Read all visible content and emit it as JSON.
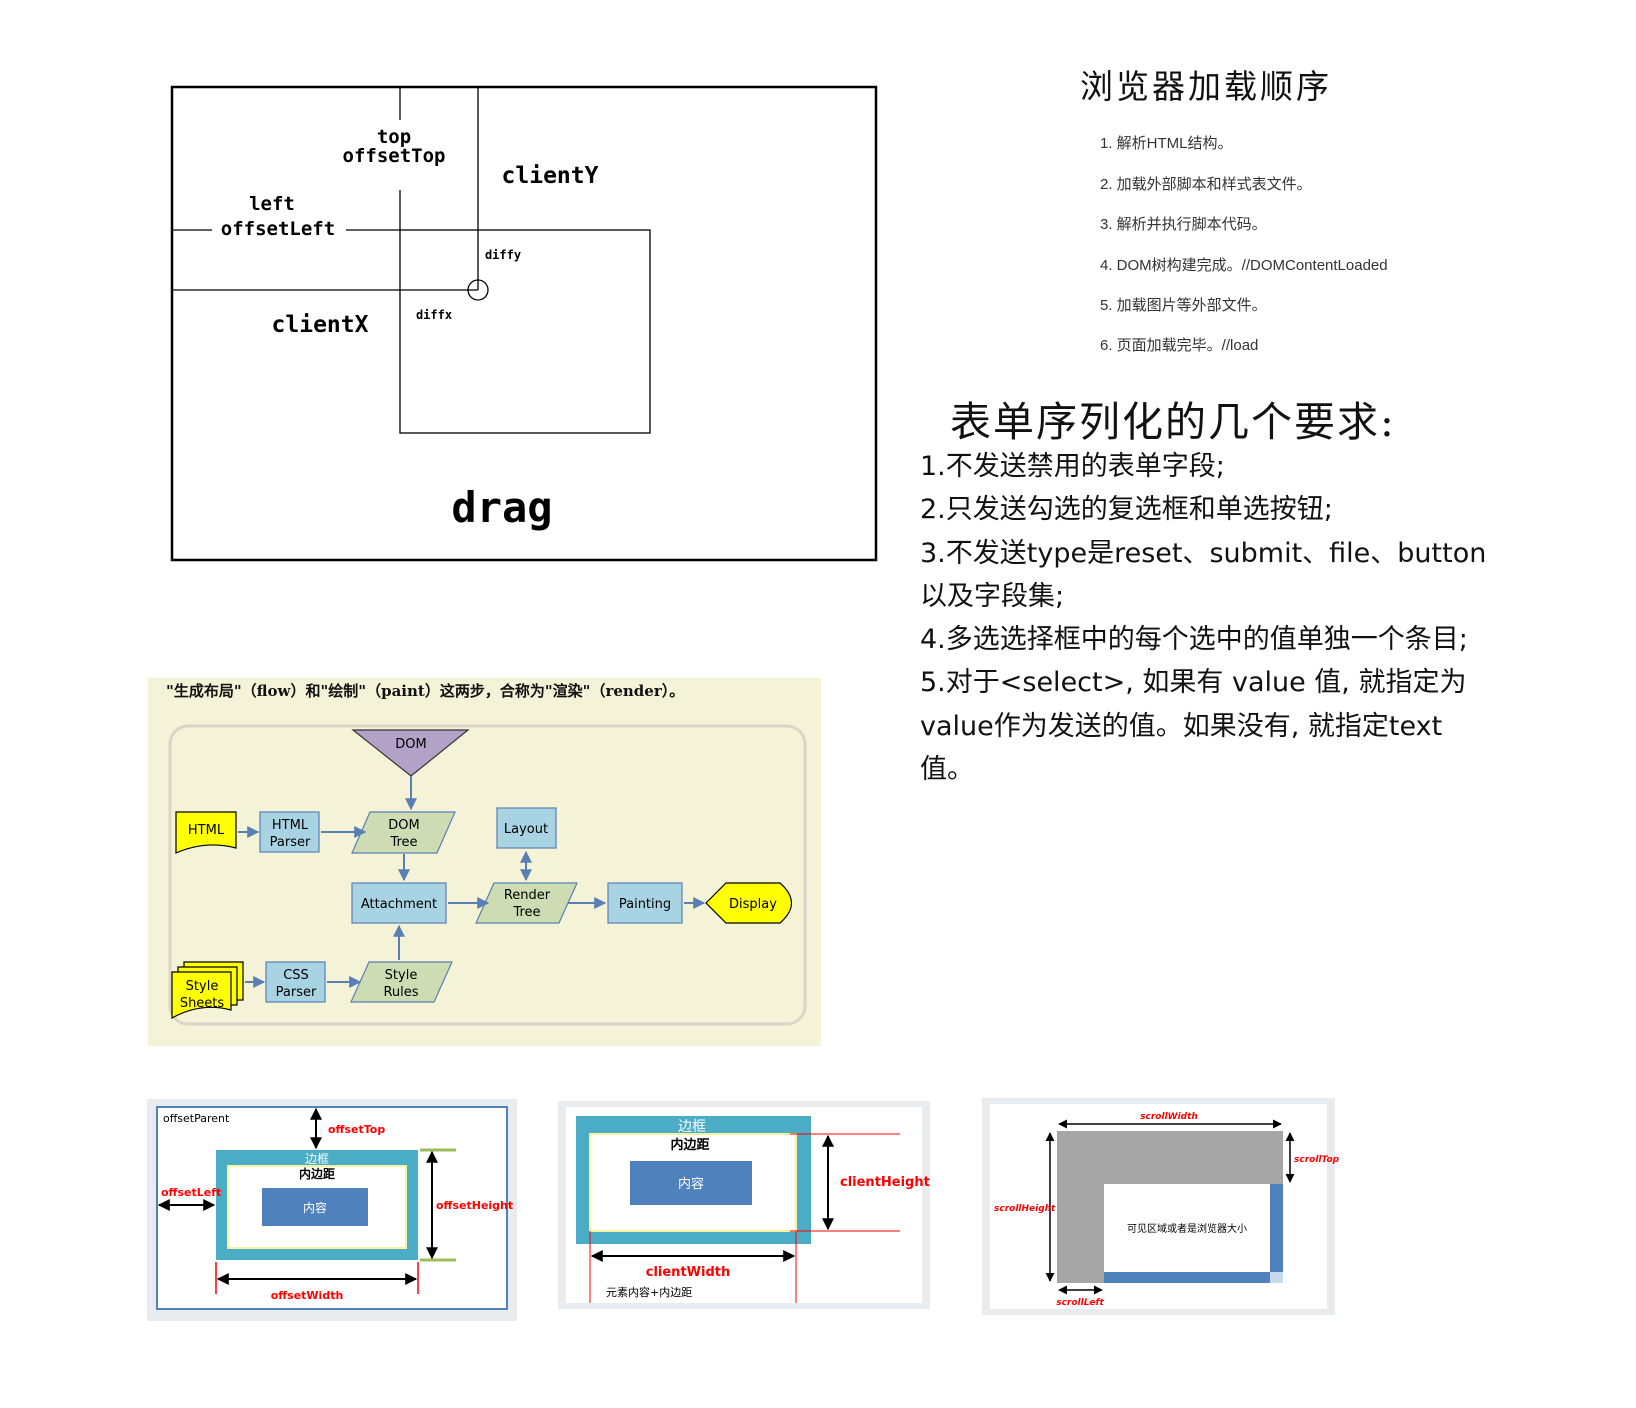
{
  "drag_diagram": {
    "top": "top",
    "offset_top": "offsetTop",
    "client_y": "clientY",
    "left": "left",
    "offset_left": "offsetLeft",
    "diffy": "diffy",
    "client_x": "clientX",
    "diffx": "diffx",
    "title": "drag"
  },
  "load_order": {
    "title": "浏览器加载顺序",
    "steps": [
      "1. 解析HTML结构。",
      "2. 加载外部脚本和样式表文件。",
      "3. 解析并执行脚本代码。",
      "4. DOM树构建完成。//DOMContentLoaded",
      "5. 加载图片等外部文件。",
      "6. 页面加载完毕。//load"
    ]
  },
  "form_serialize": {
    "title": "表单序列化的几个要求:",
    "lines": [
      "1.不发送禁用的表单字段;",
      "2.只发送勾选的复选框和单选按钮;",
      "3.不发送type是reset、submit、file、button",
      "以及字段集;",
      "4.多选选择框中的每个选中的值单独一个条目;",
      "5.对于<select>, 如果有 value 值, 就指定为",
      "value作为发送的值。如果没有, 就指定text",
      "值。"
    ]
  },
  "render_flow": {
    "caption": "\"生成布局\"（flow）和\"绘制\"（paint）这两步，合称为\"渲染\"（render）。",
    "nodes": {
      "dom": "DOM",
      "html": "HTML",
      "html_parser_1": "HTML",
      "html_parser_2": "Parser",
      "dom_tree_1": "DOM",
      "dom_tree_2": "Tree",
      "layout": "Layout",
      "attachment": "Attachment",
      "render_tree_1": "Render",
      "render_tree_2": "Tree",
      "painting": "Painting",
      "display": "Display",
      "style_sheets_1": "Style",
      "style_sheets_2": "Sheets",
      "css_parser_1": "CSS",
      "css_parser_2": "Parser",
      "style_rules_1": "Style",
      "style_rules_2": "Rules"
    },
    "colors": {
      "background": "#f5f3d7",
      "box": "#a8d3e3",
      "parallelogram": "#cddcb2",
      "yellow": "#ffff00",
      "triangle": "#b3a2c7",
      "arrow": "#5a7fb5"
    }
  },
  "offset_diagram": {
    "offset_parent": "offsetParent",
    "offset_top": "offsetTop",
    "border": "边框",
    "padding": "内边距",
    "content": "内容",
    "offset_left": "offsetLeft",
    "offset_height": "offsetHeight",
    "offset_width": "offsetWidth"
  },
  "client_diagram": {
    "border": "边框",
    "padding": "内边距",
    "content": "内容",
    "client_height": "clientHeight",
    "client_width": "clientWidth",
    "note": "元素内容+内边距"
  },
  "scroll_diagram": {
    "scroll_width": "scrollWidth",
    "scroll_top": "scrollTop",
    "scroll_height": "scrollHeight",
    "visible_area": "可见区域或者是浏览器大小",
    "scroll_left": "scrollLeft"
  },
  "colors": {
    "border_teal": "#4bacc6",
    "content_blue": "#4f81bd",
    "label_red": "#ff0000",
    "padding_yellow": "#f5f3a0"
  }
}
